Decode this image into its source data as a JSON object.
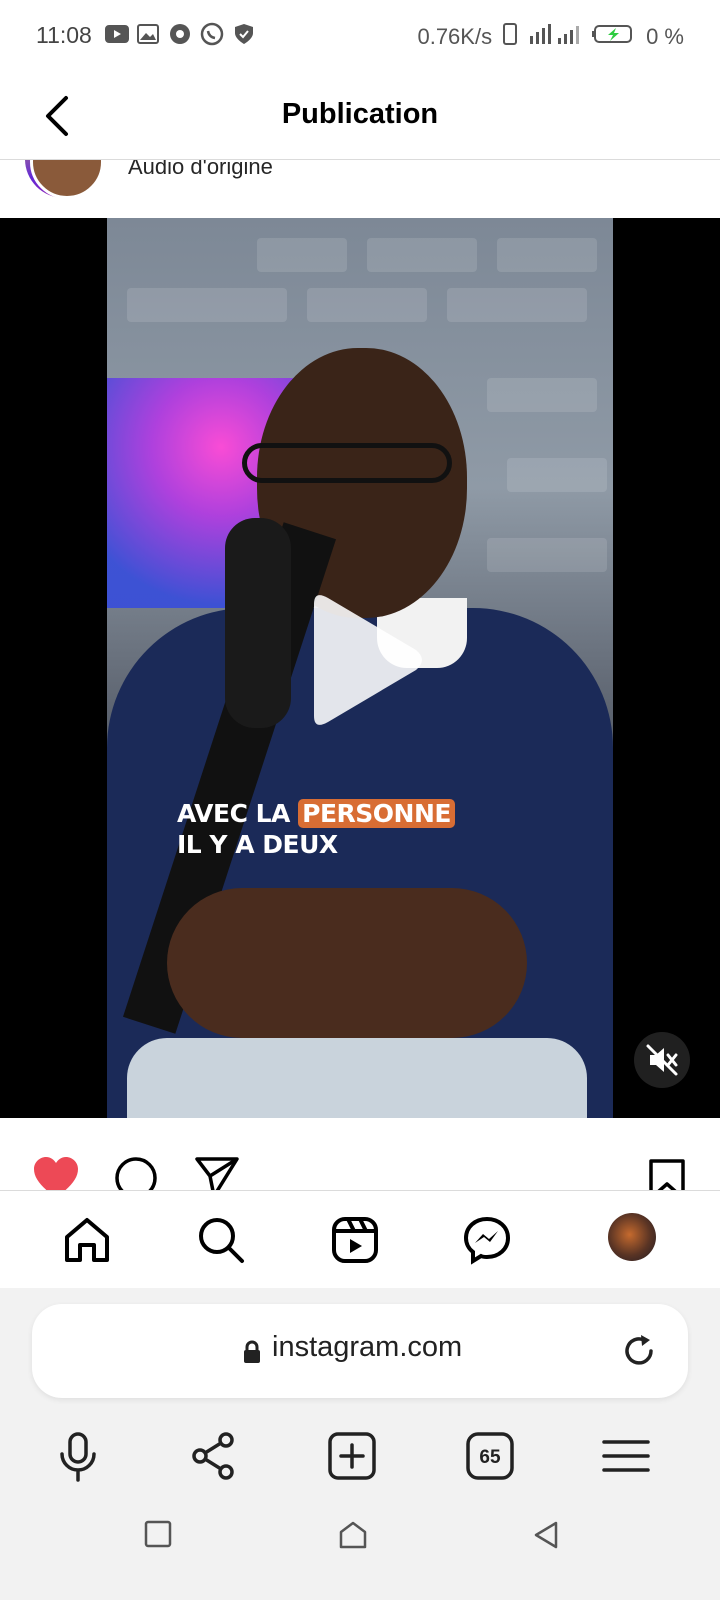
{
  "status_bar": {
    "time": "11:08",
    "network_speed": "0.76K/s",
    "battery": "0 %",
    "notification_icons": [
      "youtube-icon",
      "gallery-icon",
      "app-icon",
      "whatsapp-icon",
      "shield-icon"
    ]
  },
  "header": {
    "title": "Publication",
    "back_icon": "back-arrow-icon"
  },
  "post": {
    "audio_label": "Audio d'origine",
    "video": {
      "caption_line1_pre": "AVEC LA ",
      "caption_line1_highlight": "PERSONNE",
      "caption_line2": "IL Y A DEUX",
      "muted": true
    },
    "liked": true
  },
  "ig_nav": {
    "items": [
      "home-icon",
      "search-icon",
      "reels-icon",
      "messenger-icon",
      "profile-avatar"
    ]
  },
  "browser": {
    "url": "instagram.com",
    "tab_count": "65",
    "toolbar": [
      "mic-icon",
      "share-icon",
      "new-tab-icon",
      "tabs-icon",
      "menu-icon"
    ]
  },
  "colors": {
    "like_red": "#ed4956",
    "caption_highlight": "#d86d34",
    "browser_bg": "#f2f2f2"
  }
}
